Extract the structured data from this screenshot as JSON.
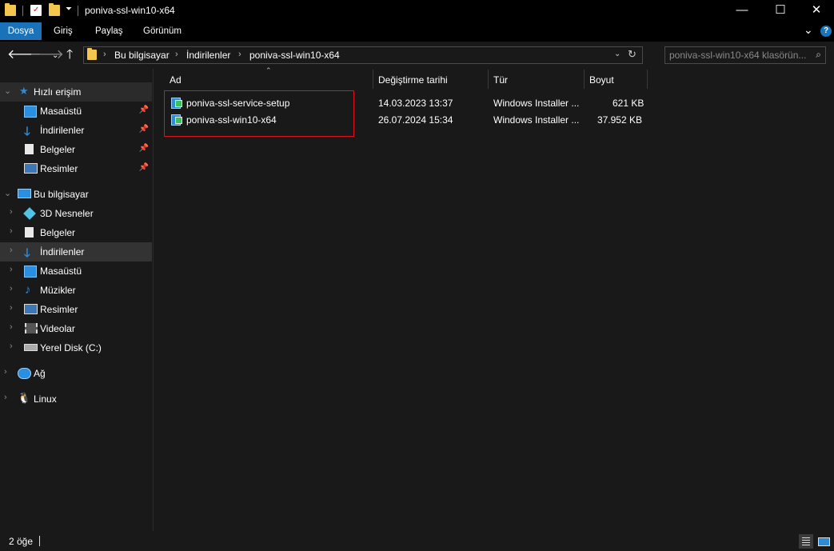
{
  "window": {
    "title": "poniva-ssl-win10-x64",
    "minimize_glyph": "—",
    "maximize_glyph": "☐",
    "close_glyph": "✕"
  },
  "ribbon": {
    "tabs": [
      "Dosya",
      "Giriş",
      "Paylaş",
      "Görünüm"
    ],
    "expand_glyph": "⌄",
    "help_glyph": "?"
  },
  "address": {
    "crumbs": [
      "Bu bilgisayar",
      "İndirilenler",
      "poniva-ssl-win10-x64"
    ],
    "search_placeholder": "poniva-ssl-win10-x64 klasörün..."
  },
  "nav": {
    "quick_access": "Hızlı erişim",
    "quick_items": [
      "Masaüstü",
      "İndirilenler",
      "Belgeler",
      "Resimler"
    ],
    "this_pc": "Bu bilgisayar",
    "pc_items": [
      "3D Nesneler",
      "Belgeler",
      "İndirilenler",
      "Masaüstü",
      "Müzikler",
      "Resimler",
      "Videolar",
      "Yerel Disk (C:)"
    ],
    "network": "Ağ",
    "linux": "Linux"
  },
  "columns": {
    "name": "Ad",
    "date": "Değiştirme tarihi",
    "type": "Tür",
    "size": "Boyut"
  },
  "files": [
    {
      "name": "poniva-ssl-service-setup",
      "date": "14.03.2023 13:37",
      "type": "Windows Installer ...",
      "size": "621 KB"
    },
    {
      "name": "poniva-ssl-win10-x64",
      "date": "26.07.2024 15:34",
      "type": "Windows Installer ...",
      "size": "37.952 KB"
    }
  ],
  "status": {
    "item_count": "2 öğe"
  },
  "colors": {
    "accent": "#1a72b8",
    "highlight_border": "#e0101d",
    "folder": "#f3c64e"
  }
}
